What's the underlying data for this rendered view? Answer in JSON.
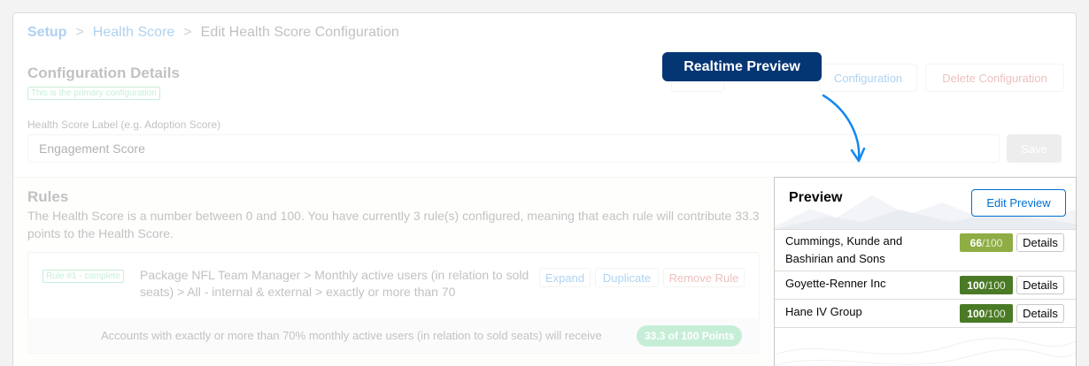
{
  "breadcrumb": {
    "items": [
      "Setup",
      "Health Score",
      "Edit Health Score Configuration"
    ],
    "separator": ">"
  },
  "config": {
    "title": "Configuration Details",
    "primary_badge": "This is the primary configuration",
    "buttons": {
      "configuration": "Configuration",
      "delete": "Delete Configuration"
    },
    "label_field": {
      "label": "Health Score Label (e.g. Adoption Score)",
      "value": "Engagement Score"
    },
    "save_label": "Save"
  },
  "rules": {
    "title": "Rules",
    "description": "The Health Score is a number between 0 and 100. You have currently 3 rule(s) configured, meaning that each rule will contribute 33.3 points to the Health Score.",
    "rule1": {
      "badge": "Rule #1 - complete",
      "text": "Package NFL Team Manager > Monthly active users (in relation to sold seats) > All - internal & external > exactly or more than 70",
      "expand": "Expand",
      "duplicate": "Duplicate",
      "remove": "Remove Rule",
      "result": "Accounts with exactly or more than 70% monthly active users (in relation to sold seats) will receive",
      "points": "33.3 of 100 Points"
    }
  },
  "callout": {
    "label": "Realtime Preview"
  },
  "preview": {
    "title": "Preview",
    "edit_label": "Edit Preview",
    "rows": [
      {
        "name": "Cummings, Kunde and Bashirian and Sons",
        "score": "66",
        "max": "/100",
        "details": "Details",
        "color": "#8fad45"
      },
      {
        "name": "Goyette-Renner Inc",
        "score": "100",
        "max": "/100",
        "details": "Details",
        "color": "#4a7a26"
      },
      {
        "name": "Hane IV Group",
        "score": "100",
        "max": "/100",
        "details": "Details",
        "color": "#4a7a26"
      }
    ]
  },
  "colors": {
    "accent": "#0070d2",
    "callout_bg": "#053674",
    "success": "#4bca81"
  }
}
